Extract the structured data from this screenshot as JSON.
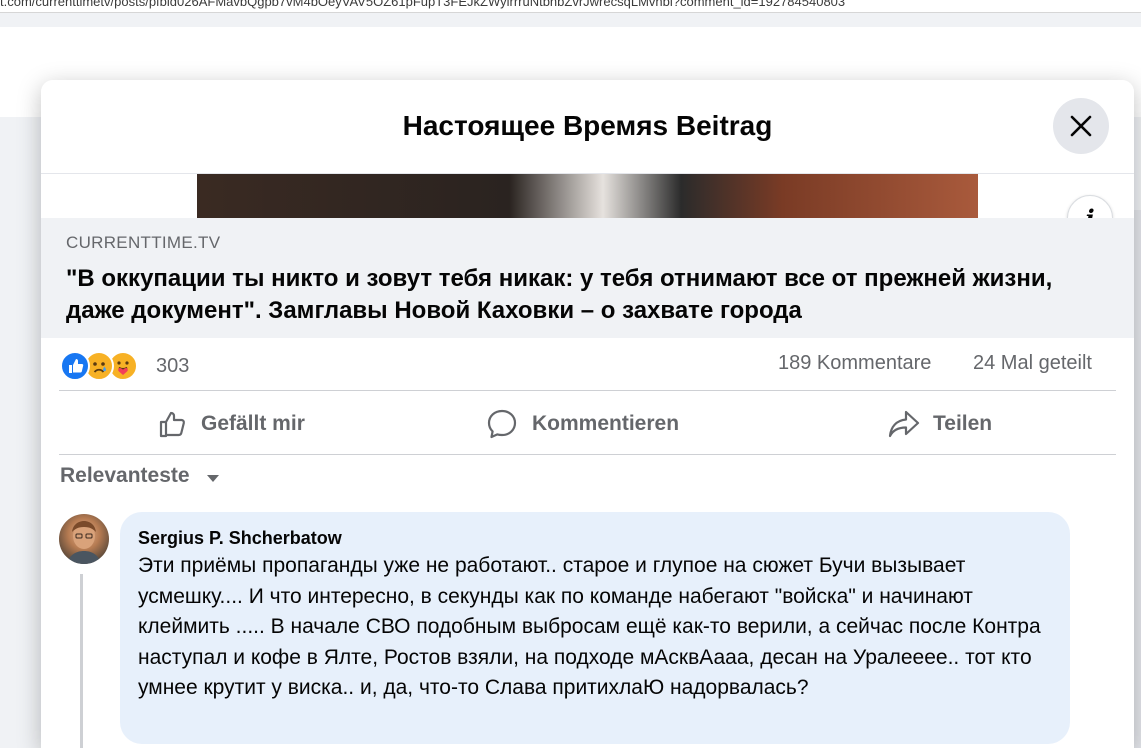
{
  "browser": {
    "url": "t.com/currenttimetv/posts/pfbid026AFMavbQgpb7vM4bOeyVAV5OZ61pFupT3FEJkZWyirrruNtbnbZvrJwrecsqLMvhbl?comment_id=192784540803"
  },
  "modal": {
    "title": "Настоящее Времяs Beitrag",
    "close_label": "×",
    "info_label": "i"
  },
  "link_preview": {
    "domain": "CURRENTTIME.TV",
    "title": "\"В оккупации ты никто и зовут тебя никак: у тебя отнимают все от прежней жизни, даже документ\". Замглавы Новой Каховки – о захвате города"
  },
  "stats": {
    "reactions": [
      "like-icon",
      "sad-icon",
      "care-icon"
    ],
    "reaction_count": "303",
    "comments": "189 Kommentare",
    "shares": "24 Mal geteilt"
  },
  "actions": {
    "like": "Gefällt mir",
    "comment": "Kommentieren",
    "share": "Teilen"
  },
  "sort": {
    "label": "Relevanteste"
  },
  "comment": {
    "author": "Sergius P. Shcherbatow",
    "text": "Эти приёмы пропаганды уже не работают.. старое и глупое на сюжет Бучи вызывает усмешку.... И что интересно, в секунды как по команде набегают \"войска\" и начинают клеймить ..... В начале СВО подобным выбросам ещё как-то верили, а сейчас после Контра наступал и кофе в Ялте, Ростов взяли, на подходе мАсквАааа, десан на Уралееее.. тот кто умнее крутит у виска.. и, да, что-то Слава притихлаЮ надорвалась?"
  },
  "colors": {
    "brand": "#1877f2",
    "secondary_text": "#65676b",
    "bubble": "#e7f0fb",
    "card_bg": "#f0f2f5"
  }
}
